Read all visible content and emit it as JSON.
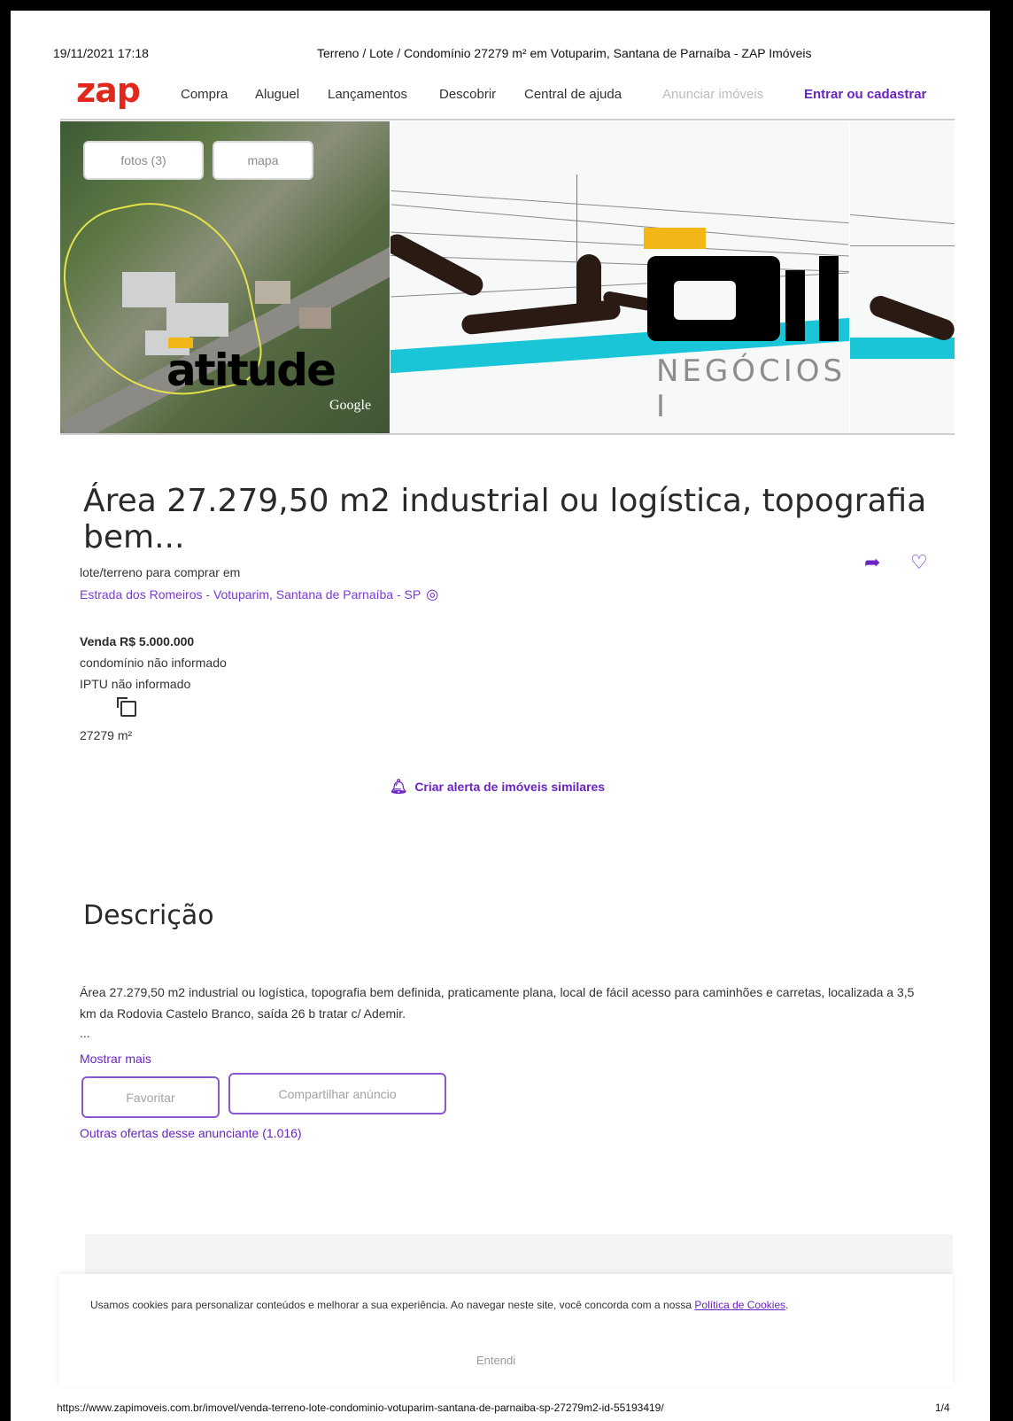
{
  "print": {
    "timestamp": "19/11/2021 17:18",
    "title": "Terreno / Lote / Condomínio 27279 m² em Votuparim, Santana de Parnaíba - ZAP Imóveis",
    "url": "https://www.zapimoveis.com.br/imovel/venda-terreno-lote-condominio-votuparim-santana-de-parnaiba-sp-27279m2-id-55193419/",
    "page": "1/4"
  },
  "nav": {
    "logo": "zap",
    "items": [
      "Compra",
      "Aluguel",
      "Lançamentos",
      "Descobrir",
      "Central de ajuda"
    ],
    "announce": "Anunciar imóveis",
    "login": "Entrar ou cadastrar"
  },
  "gallery": {
    "photos_button": "fotos (3)",
    "map_button": "mapa",
    "watermark": "atitude",
    "watermark2": "NEGÓCIOS I",
    "google": "Google"
  },
  "listing": {
    "title": "Área 27.279,50 m2 industrial ou logística, topografia bem...",
    "type_line": "lote/terreno para comprar em",
    "address": "Estrada dos Romeiros - Votuparim, Santana de Parnaíba - SP",
    "price": "Venda R$ 5.000.000",
    "condo": "condomínio não informado",
    "iptu": "IPTU não informado",
    "area": "27279 m²",
    "alert": "Criar alerta de imóveis similares"
  },
  "description": {
    "heading": "Descrição",
    "text": "Área 27.279,50 m2 industrial ou logística, topografia bem definida, praticamente plana, local de fácil acesso para caminhões e carretas, localizada a 3,5 km da Rodovia Castelo Branco, saída 26 b tratar c/ Ademir.",
    "ellipsis": "...",
    "show_more": "Mostrar mais",
    "favorite": "Favoritar",
    "share": "Compartilhar anúncio",
    "other_offers": "Outras ofertas desse anunciante (1.016)"
  },
  "cookie": {
    "text": "Usamos cookies para personalizar conteúdos e melhorar a sua experiência. Ao navegar neste site, você concorda com a nossa",
    "link": "Política de Cookies",
    "period": ".",
    "ok": "Entendi"
  },
  "colors": {
    "brand": "#e0281d",
    "accent": "#6b24c2"
  }
}
